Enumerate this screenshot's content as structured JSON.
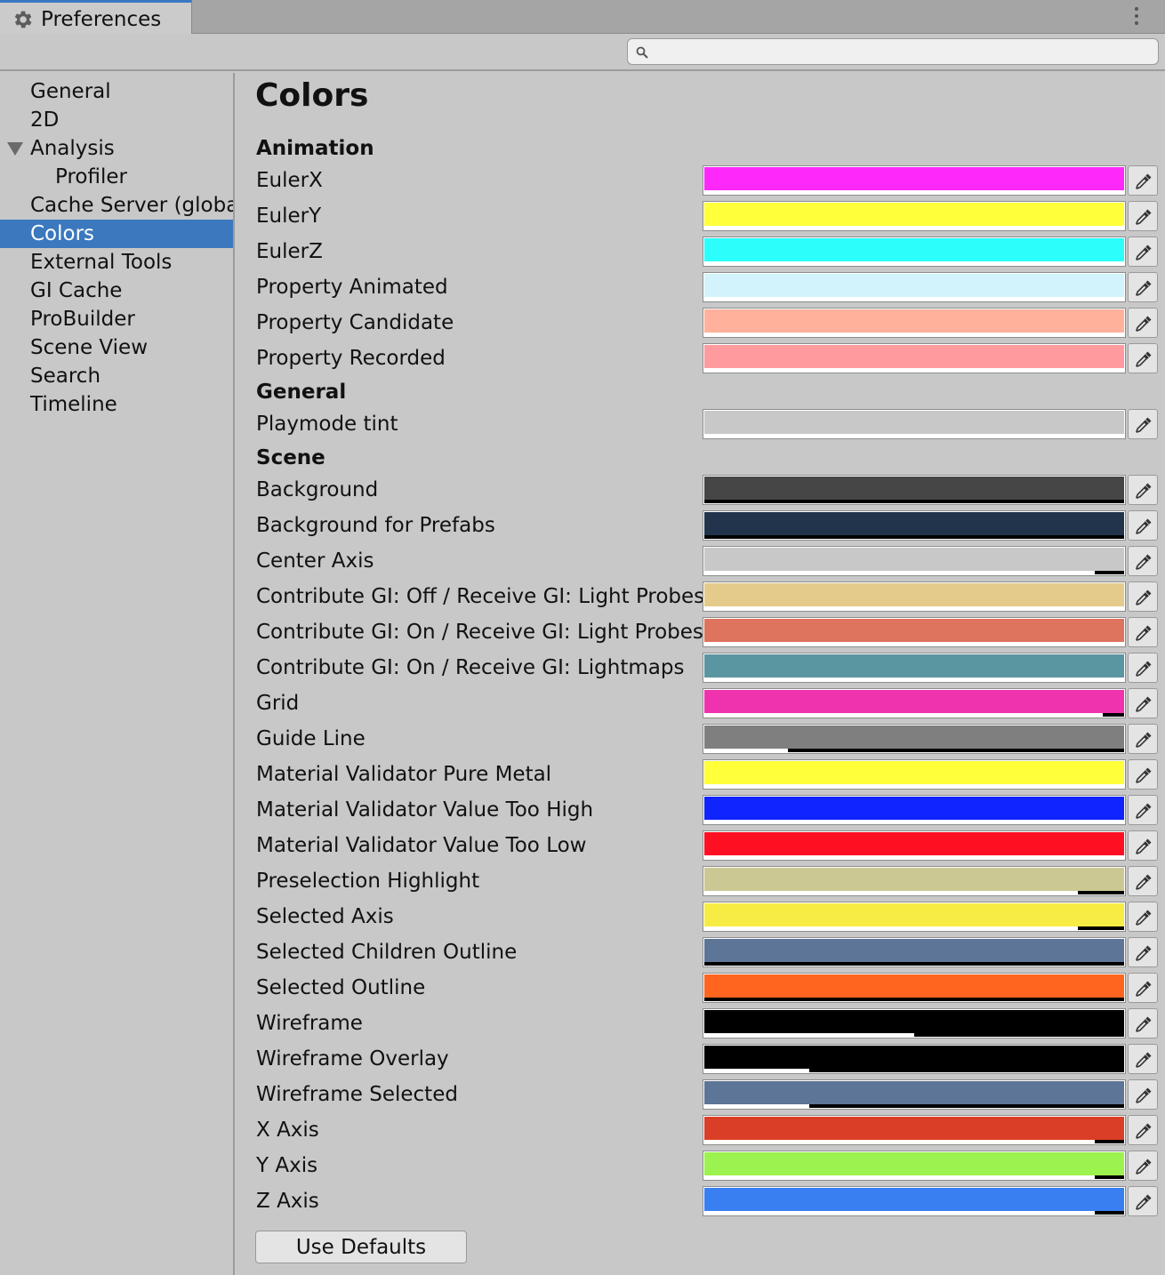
{
  "window": {
    "tab_title": "Preferences",
    "tab_icon": "gear-icon"
  },
  "search": {
    "value": "",
    "placeholder": ""
  },
  "sidebar": {
    "items": [
      {
        "label": "General",
        "indent": 0,
        "selected": false
      },
      {
        "label": "2D",
        "indent": 0,
        "selected": false
      },
      {
        "label": "Analysis",
        "indent": 0,
        "selected": false,
        "expanded": true
      },
      {
        "label": "Profiler",
        "indent": 1,
        "selected": false
      },
      {
        "label": "Cache Server (global)",
        "indent": 0,
        "selected": false
      },
      {
        "label": "Colors",
        "indent": 0,
        "selected": true
      },
      {
        "label": "External Tools",
        "indent": 0,
        "selected": false
      },
      {
        "label": "GI Cache",
        "indent": 0,
        "selected": false
      },
      {
        "label": "ProBuilder",
        "indent": 0,
        "selected": false
      },
      {
        "label": "Scene View",
        "indent": 0,
        "selected": false
      },
      {
        "label": "Search",
        "indent": 0,
        "selected": false
      },
      {
        "label": "Timeline",
        "indent": 0,
        "selected": false
      }
    ]
  },
  "main": {
    "title": "Colors",
    "sections": [
      {
        "header": "Animation",
        "rows": [
          {
            "label": "EulerX",
            "color": "#ff28fb",
            "alpha": 1.0
          },
          {
            "label": "EulerY",
            "color": "#ffff3a",
            "alpha": 1.0
          },
          {
            "label": "EulerZ",
            "color": "#2cfffb",
            "alpha": 1.0
          },
          {
            "label": "Property Animated",
            "color": "#d3f3fc",
            "alpha": 1.0
          },
          {
            "label": "Property Candidate",
            "color": "#ffb19b",
            "alpha": 1.0
          },
          {
            "label": "Property Recorded",
            "color": "#ff9b9e",
            "alpha": 1.0
          }
        ]
      },
      {
        "header": "General",
        "rows": [
          {
            "label": "Playmode tint",
            "color": "#c8c8c8",
            "alpha": 1.0
          }
        ]
      },
      {
        "header": "Scene",
        "rows": [
          {
            "label": "Background",
            "color": "#464646",
            "alpha": 0.0
          },
          {
            "label": "Background for Prefabs",
            "color": "#21344c",
            "alpha": 0.0
          },
          {
            "label": "Center Axis",
            "color": "#c8c8c8",
            "alpha": 0.93
          },
          {
            "label": "Contribute GI: Off / Receive GI: Light Probes",
            "color": "#e4cb8c",
            "alpha": 1.0
          },
          {
            "label": "Contribute GI: On / Receive GI: Light Probes",
            "color": "#de735e",
            "alpha": 1.0
          },
          {
            "label": "Contribute GI: On / Receive GI: Lightmaps",
            "color": "#5a96a1",
            "alpha": 1.0
          },
          {
            "label": "Grid",
            "color": "#ef33ae",
            "alpha": 0.95
          },
          {
            "label": "Guide Line",
            "color": "#7f7f7f",
            "alpha": 0.2
          },
          {
            "label": "Material Validator Pure Metal",
            "color": "#ffff3a",
            "alpha": 1.0
          },
          {
            "label": "Material Validator Value Too High",
            "color": "#1024fd",
            "alpha": 1.0
          },
          {
            "label": "Material Validator Value Too Low",
            "color": "#fe0f22",
            "alpha": 1.0
          },
          {
            "label": "Preselection Highlight",
            "color": "#cbc894",
            "alpha": 0.89
          },
          {
            "label": "Selected Axis",
            "color": "#f6ec44",
            "alpha": 0.89
          },
          {
            "label": "Selected Children Outline",
            "color": "#5d7597",
            "alpha": 0.0
          },
          {
            "label": "Selected Outline",
            "color": "#ff651e",
            "alpha": 0.0
          },
          {
            "label": "Wireframe",
            "color": "#000000",
            "alpha": 0.5
          },
          {
            "label": "Wireframe Overlay",
            "color": "#000000",
            "alpha": 0.25
          },
          {
            "label": "Wireframe Selected",
            "color": "#5d7597",
            "alpha": 0.25
          },
          {
            "label": "X Axis",
            "color": "#db3e26",
            "alpha": 0.93
          },
          {
            "label": "Y Axis",
            "color": "#9cf24e",
            "alpha": 0.93
          },
          {
            "label": "Z Axis",
            "color": "#3a7ff2",
            "alpha": 0.93
          }
        ]
      }
    ],
    "use_defaults_label": "Use Defaults"
  }
}
